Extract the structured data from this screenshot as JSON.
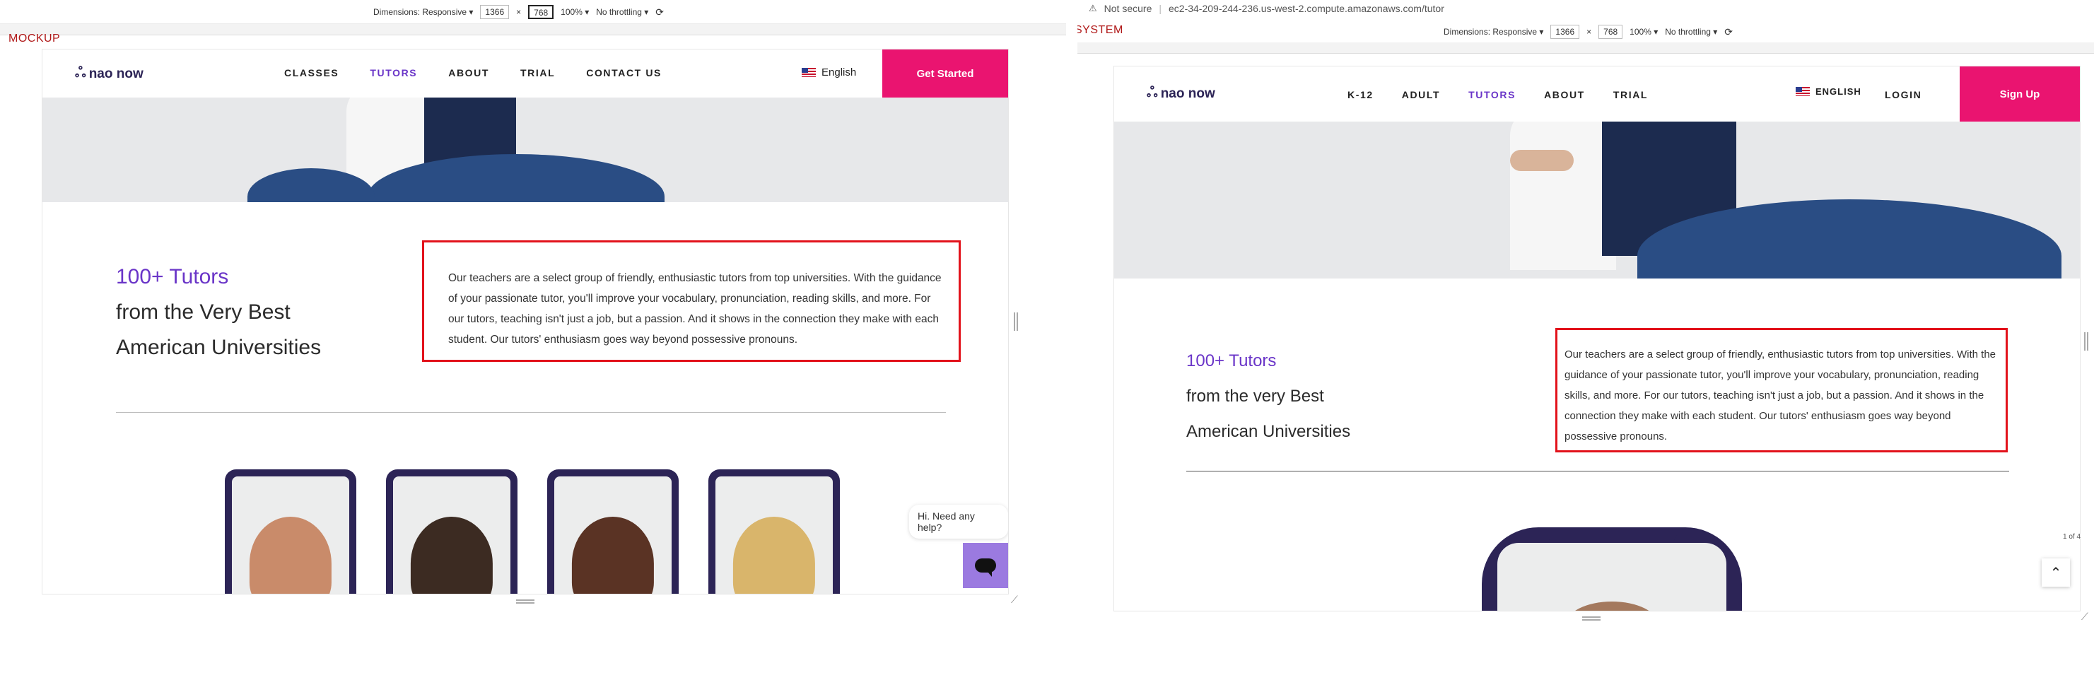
{
  "mockup": {
    "tag": "MOCKUP",
    "devtools": {
      "dimensions_label": "Dimensions: Responsive ▾",
      "width": "1366",
      "x": "×",
      "height": "768",
      "zoom": "100% ▾",
      "throttle": "No throttling ▾"
    },
    "nav": {
      "logo": "nao now",
      "links": [
        "CLASSES",
        "TUTORS",
        "ABOUT",
        "TRIAL",
        "CONTACT US"
      ],
      "active_index": 1,
      "language": "English",
      "cta": "Get Started"
    },
    "heading": {
      "accent": "100+ Tutors",
      "line2": "from the Very Best",
      "line3": "American Universities"
    },
    "paragraph": "Our teachers are a select group of friendly, enthusiastic tutors from top universities. With the guidance of your passionate tutor, you'll improve your vocabulary, pronunciation, reading skills, and more. For our tutors, teaching isn't just a job, but a passion. And it shows in the connection they make with each student. Our tutors' enthusiasm goes way beyond possessive pronouns.",
    "chat_bubble": "Hi. Need any help?",
    "icons": {
      "chat": "chat-icon",
      "flag": "us-flag-icon",
      "logo": "butterfly-logo-icon"
    }
  },
  "system": {
    "tag": "SYSTEM",
    "browser": {
      "security": "Not secure",
      "url": "ec2-34-209-244-236.us-west-2.compute.amazonaws.com/tutor"
    },
    "devtools": {
      "dimensions_label": "Dimensions: Responsive ▾",
      "width": "1366",
      "x": "×",
      "height": "768",
      "zoom": "100% ▾",
      "throttle": "No throttling ▾"
    },
    "nav": {
      "logo": "nao now",
      "links": [
        "K-12",
        "ADULT",
        "TUTORS",
        "ABOUT",
        "TRIAL"
      ],
      "active_index": 2,
      "language": "ENGLISH",
      "login": "LOGIN",
      "cta": "Sign Up"
    },
    "heading": {
      "accent": "100+ Tutors",
      "line2": "from the very Best",
      "line3": "American Universities"
    },
    "paragraph": "Our teachers are a select group of friendly, enthusiastic tutors from top universities. With the guidance of your passionate tutor, you'll improve your vocabulary, pronunciation, reading skills, and more. For our tutors, teaching isn't just a job, but a passion. And it shows in the connection they make with each student. Our tutors' enthusiasm goes way beyond possessive pronouns.",
    "page_indicator": "1 of 4",
    "icons": {
      "scroll_top": "chevron-up-icon",
      "warning": "warning-icon"
    }
  },
  "colors": {
    "accent_purple": "#6a35c8",
    "cta_pink": "#ea1470",
    "highlight_red": "#e2121b",
    "navy": "#2c2456"
  }
}
